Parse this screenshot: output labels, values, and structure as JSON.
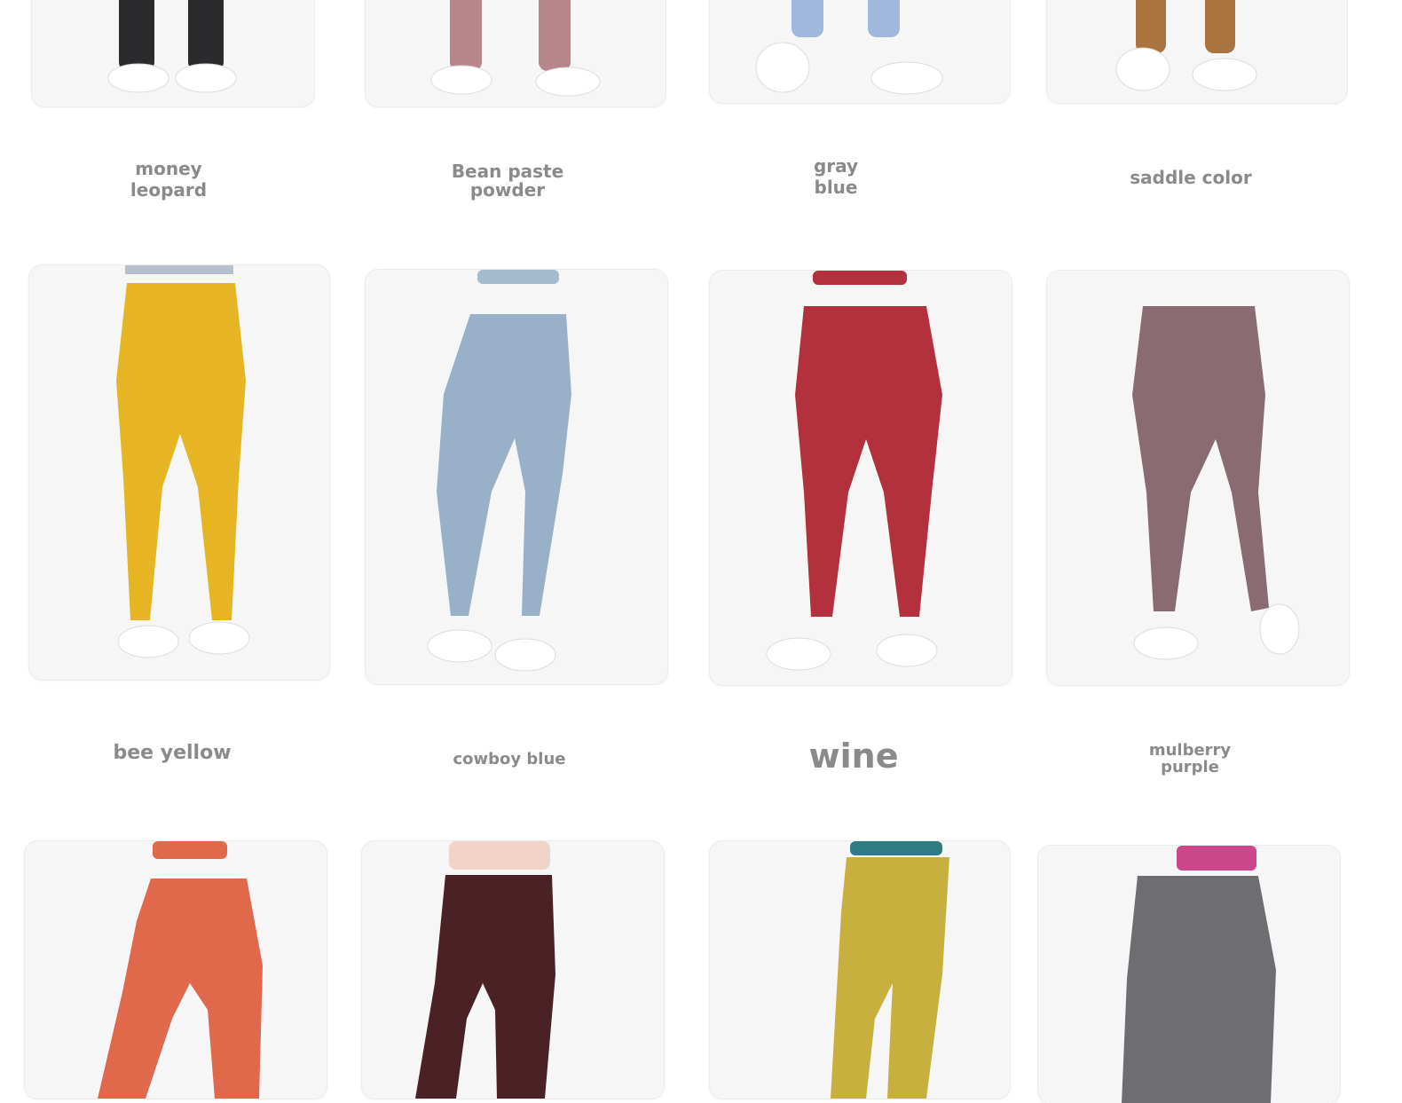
{
  "products": [
    {
      "label_lines": [
        "money",
        "leopard"
      ],
      "legging_color": "#2b2b2e",
      "top_color": "#2b2b2e"
    },
    {
      "label_lines": [
        "Bean paste",
        "powder"
      ],
      "legging_color": "#b8868a",
      "top_color": "#b8868a"
    },
    {
      "label_lines": [
        "gray",
        "blue"
      ],
      "legging_color": "#9fb8dc",
      "top_color": "#9fb8dc"
    },
    {
      "label_lines": [
        "saddle color"
      ],
      "legging_color": "#a9743f",
      "top_color": "#a9743f"
    },
    {
      "label_lines": [
        "bee yellow"
      ],
      "legging_color": "#e7b424",
      "top_color": "#b6c0cc"
    },
    {
      "label_lines": [
        "cowboy blue"
      ],
      "legging_color": "#98b1c8",
      "top_color": "#a4bcd0"
    },
    {
      "label_lines": [
        "wine"
      ],
      "legging_color": "#b3303d",
      "top_color": "#b3303d"
    },
    {
      "label_lines": [
        "mulberry",
        "purple"
      ],
      "legging_color": "#8a6b72",
      "top_color": "#8a6b72"
    },
    {
      "label_lines": [],
      "legging_color": "#e0694b",
      "top_color": "#e0694b"
    },
    {
      "label_lines": [],
      "legging_color": "#4a2226",
      "top_color": "#f1d3c8"
    },
    {
      "label_lines": [],
      "legging_color": "#c8b03e",
      "top_color": "#2d7d82"
    },
    {
      "label_lines": [],
      "legging_color": "#6e6e72",
      "top_color": "#c9478a"
    }
  ]
}
